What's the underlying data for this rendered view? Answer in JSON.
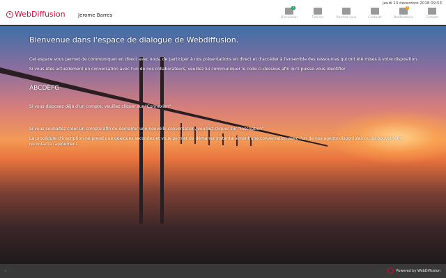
{
  "header": {
    "date": "jeudi 13 décembre 2018 09:53",
    "logo": "WebDiffusion",
    "user": "Jerome Barres",
    "nav": [
      {
        "label": "Discussion",
        "icon": "chat-icon",
        "badge": "1",
        "badge_color": "#1aa56a"
      },
      {
        "label": "Fichiers",
        "icon": "folder-icon"
      },
      {
        "label": "Rendez-vous",
        "icon": "calendar-icon"
      },
      {
        "label": "Contacts",
        "icon": "contacts-icon"
      },
      {
        "label": "Notifications",
        "icon": "bell-icon",
        "badge": "!",
        "badge_color": "#f0a020"
      },
      {
        "label": "Compte",
        "icon": "user-icon"
      }
    ]
  },
  "main": {
    "title": "Bienvenue dans l'espace de dialogue de Webdiffusion.",
    "p1": "Cet espace vous permet de communiquer en direct avec nous, de participer à nos présentations en direct et d'accéder à l'ensemble des ressources qui ont été mises à votre disposition.",
    "p2": "Si vous êtes actuellement en conversation avec l'un de nos collaborateurs, veuillez lui communiquer le code ci-dessous afin qu'il puisse vous identifier",
    "code": "ABCDEFG",
    "p3": "Si vous disposez déjà d'un compte, veuillez cliquer sur \"Connexion\"",
    "p4": "Si vous souhaitez créer un compte afin de démarrer une nouvelle conversation, veuillez cliquer sur \"Inscription\"",
    "p5": "La procédure d'inscription ne prend que quelques secondes et vous permet de démarrer instantanément une conversation avec l'un de nos agents disponibles ou de pouvoir être recontacté rapidement."
  },
  "footer": {
    "powered": "Powered by WebDiffusion"
  }
}
